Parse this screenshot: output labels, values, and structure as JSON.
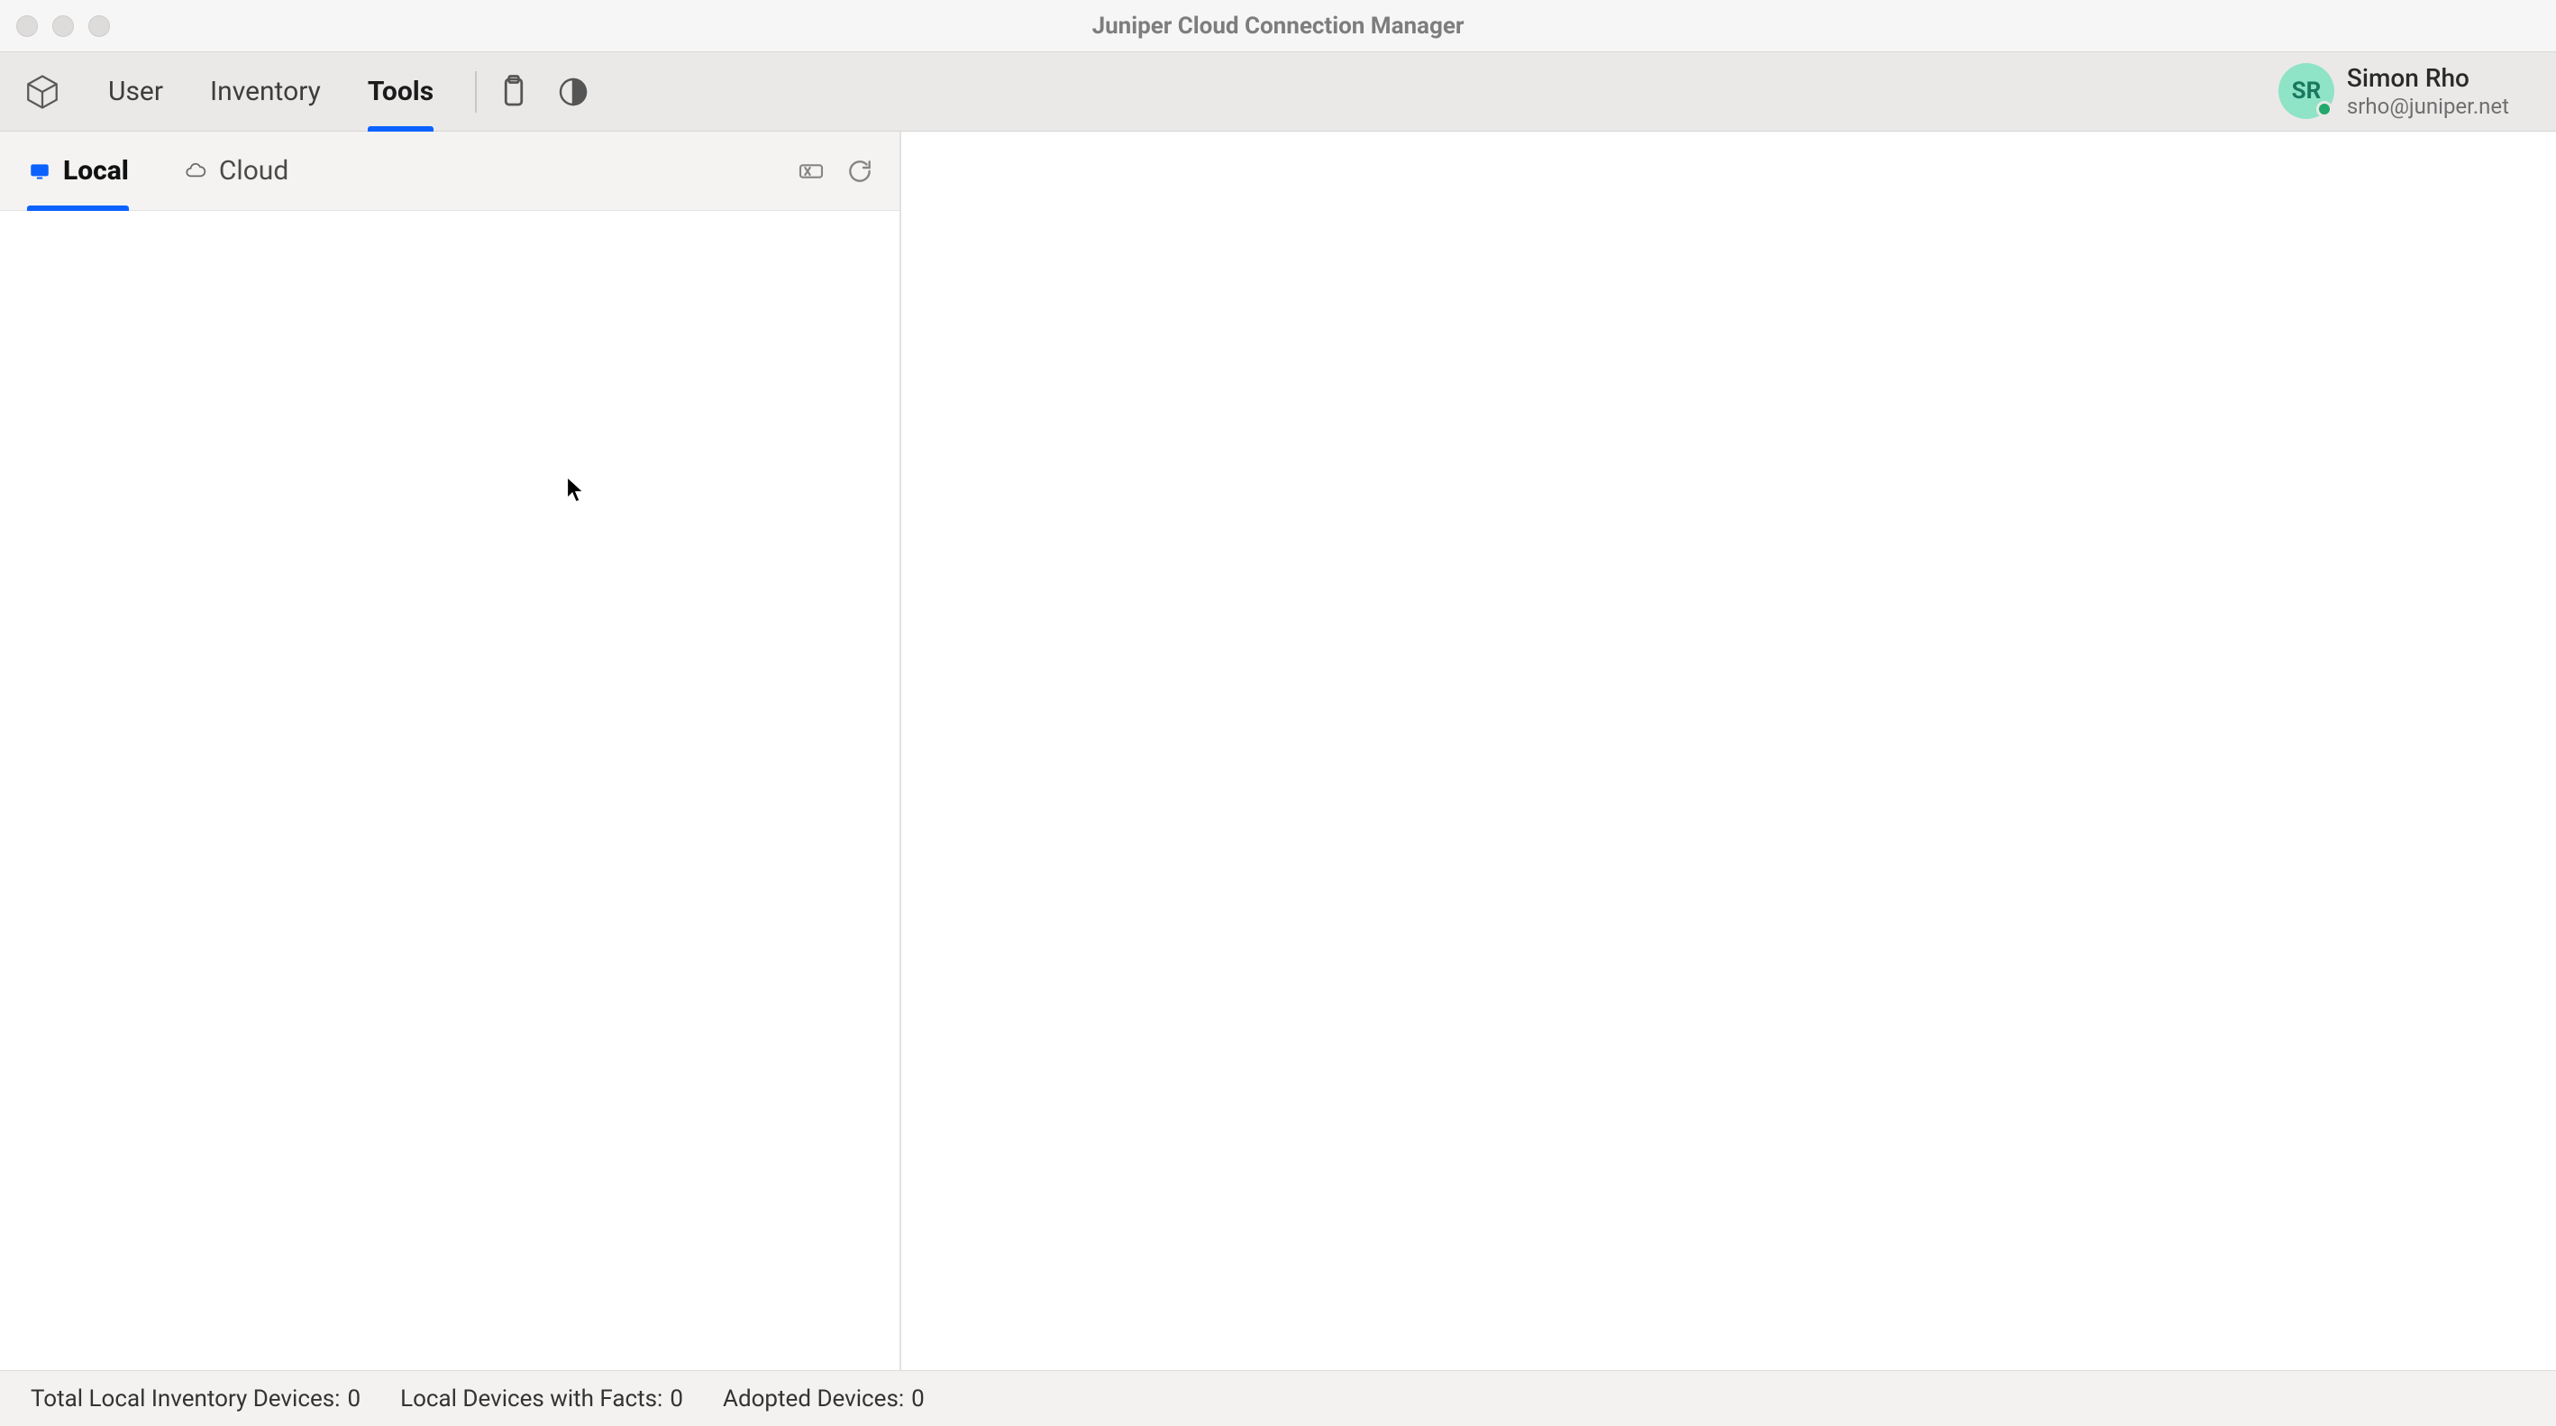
{
  "window": {
    "title": "Juniper Cloud Connection Manager"
  },
  "toolbar": {
    "tabs": [
      {
        "label": "User",
        "active": false
      },
      {
        "label": "Inventory",
        "active": false
      },
      {
        "label": "Tools",
        "active": true
      }
    ]
  },
  "user": {
    "initials": "SR",
    "name": "Simon Rho",
    "email": "srho@juniper.net"
  },
  "left_panel": {
    "tabs": [
      {
        "label": "Local",
        "active": true
      },
      {
        "label": "Cloud",
        "active": false
      }
    ]
  },
  "status": {
    "total_label": "Total Local Inventory Devices:",
    "total_value": "0",
    "facts_label": "Local Devices with Facts:",
    "facts_value": "0",
    "adopted_label": "Adopted Devices:",
    "adopted_value": "0"
  }
}
